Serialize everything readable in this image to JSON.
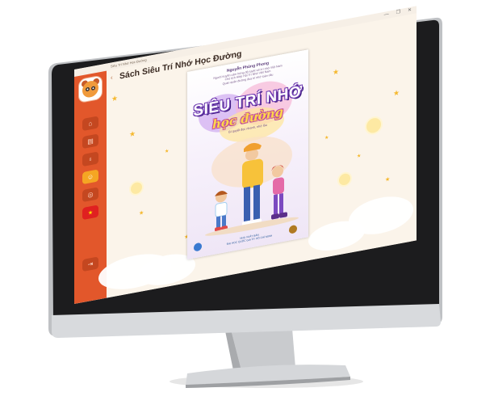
{
  "window": {
    "app_title": "Siêu Trí Nhớ Học Đường",
    "minimize_glyph": "—",
    "maximize_glyph": "❐",
    "close_glyph": "✕"
  },
  "header": {
    "back_glyph": "‹",
    "title": "Sách Siêu Trí Nhớ Học Đường"
  },
  "sidebar": {
    "items": [
      {
        "icon": "home-icon",
        "glyph": "⌂"
      },
      {
        "icon": "book-icon",
        "glyph": "▤"
      },
      {
        "icon": "lightbulb-icon",
        "glyph": "♁"
      },
      {
        "icon": "user-icon",
        "glyph": "☺",
        "active": true
      },
      {
        "icon": "chat-icon",
        "glyph": "◎"
      },
      {
        "icon": "vietnam-flag-icon",
        "glyph": "★"
      }
    ],
    "logout": {
      "icon": "logout-icon",
      "glyph": "⇥"
    }
  },
  "book": {
    "author": "Nguyễn Phùng Phong",
    "subtitle_lines": [
      "Người truyền cảm hứng độ tuyệt vời trí nhớ Việt Nam",
      "Chủ tịch Hiệp Hội Trí Nhớ Việt Nam",
      "Quán quân đường đua trí nhớ toàn cầu"
    ],
    "title_line1": "SIÊU TRÍ NHỚ",
    "title_line2": "học đường",
    "tagline": "Bí quyết đọc nhanh, nhớ lâu",
    "publisher_lines": [
      "NHÀ XUẤT BẢN",
      "ĐẠI HỌC QUỐC GIA TP. HỒ CHÍ MINH"
    ]
  },
  "colors": {
    "sidebar": "#e2572b",
    "nav_active": "#f5a623",
    "background": "#fbf4ea",
    "title_text": "#3a2a22"
  }
}
